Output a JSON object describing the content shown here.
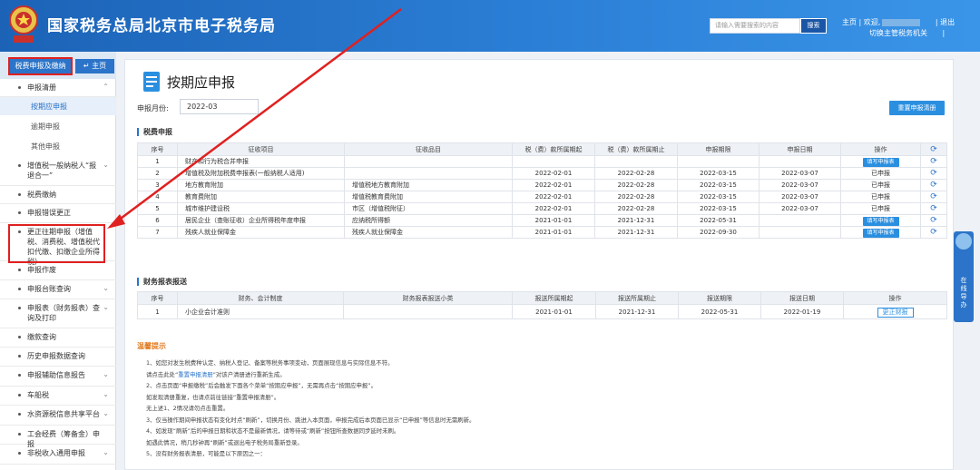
{
  "header": {
    "title": "国家税务总局北京市电子税务局",
    "search_placeholder": "请输入需要搜索的内容",
    "search_button": "搜索",
    "home_link": "主页",
    "sep1": "|",
    "welcome": "欢迎,",
    "sep2": "|",
    "logout": "退出",
    "switch_agency": "切换主管税务机关",
    "sep3": "|"
  },
  "sidebar": {
    "active_tab": "税费申报及缴纳",
    "home_tab": "主页",
    "home_icon": "arrow-left-icon",
    "items": [
      {
        "label": "申报清册"
      },
      {
        "label": "增值税一般纳税人“报退合一”"
      },
      {
        "label": "税费缴纳"
      },
      {
        "label": "申报错误更正"
      },
      {
        "label": "更正往期申报（增值税、消费税、增值税代扣代缴、扣缴企业所得税）"
      },
      {
        "label": "申报作废"
      },
      {
        "label": "申报台账查询"
      },
      {
        "label": "申报表（财务报表）查询及打印"
      },
      {
        "label": "缴款查询"
      },
      {
        "label": "历史申报数据查询"
      },
      {
        "label": "申报辅助信息报告"
      },
      {
        "label": "车船税"
      },
      {
        "label": "水资源税信息共享平台"
      },
      {
        "label": "工会经费（筹备金）申报"
      },
      {
        "label": "非税收入通用申报"
      }
    ],
    "subitems": [
      {
        "label": "按期应申报"
      },
      {
        "label": "逾期申报"
      },
      {
        "label": "其他申报"
      }
    ]
  },
  "main": {
    "title": "按期应申报",
    "month_label": "申报月份:",
    "month_value": "2022-03",
    "clear_button": "重置申报清册",
    "tax_section_title": "税费申报",
    "tax_headers": [
      "序号",
      "征收项目",
      "征收品目",
      "税（费）款所属期起",
      "税（费）款所属期止",
      "申报期限",
      "申报日期",
      "操作"
    ],
    "tax_rows": [
      {
        "no": "1",
        "item": "财产和行为税合并申报",
        "sub": "",
        "start": "",
        "end": "",
        "deadline": "",
        "date": "",
        "action": "填写申报表",
        "btn": true
      },
      {
        "no": "2",
        "item": "增值税及附加税费申报表(一般纳税人适用)",
        "sub": "",
        "start": "2022-02-01",
        "end": "2022-02-28",
        "deadline": "2022-03-15",
        "date": "2022-03-07",
        "action": "已申报",
        "btn": false
      },
      {
        "no": "3",
        "item": "地方教育附加",
        "sub": "增值税地方教育附加",
        "start": "2022-02-01",
        "end": "2022-02-28",
        "deadline": "2022-03-15",
        "date": "2022-03-07",
        "action": "已申报",
        "btn": false
      },
      {
        "no": "4",
        "item": "教育费附加",
        "sub": "增值税教育费附加",
        "start": "2022-02-01",
        "end": "2022-02-28",
        "deadline": "2022-03-15",
        "date": "2022-03-07",
        "action": "已申报",
        "btn": false
      },
      {
        "no": "5",
        "item": "城市维护建设税",
        "sub": "市区（增值税附征）",
        "start": "2022-02-01",
        "end": "2022-02-28",
        "deadline": "2022-03-15",
        "date": "2022-03-07",
        "action": "已申报",
        "btn": false
      },
      {
        "no": "6",
        "item": "居民企业（查账征收）企业所得税年度申报",
        "sub": "应纳税所得额",
        "start": "2021-01-01",
        "end": "2021-12-31",
        "deadline": "2022-05-31",
        "date": "",
        "action": "填写申报表",
        "btn": true
      },
      {
        "no": "7",
        "item": "残疾人就业保障金",
        "sub": "残疾人就业保障金",
        "start": "2021-01-01",
        "end": "2021-12-31",
        "deadline": "2022-09-30",
        "date": "",
        "action": "填写申报表",
        "btn": true
      }
    ],
    "fin_section_title": "财务报表报送",
    "fin_headers": [
      "序号",
      "财务、会计制度",
      "财务报表报送小类",
      "报送所属期起",
      "报送所属期止",
      "报送期限",
      "报送日期",
      "操作"
    ],
    "fin_rows": [
      {
        "no": "1",
        "system": "小企业会计准则",
        "sub": "",
        "start": "2021-01-01",
        "end": "2021-12-31",
        "deadline": "2022-05-31",
        "date": "2022-01-19",
        "action": "更正财报"
      }
    ],
    "tips_title": "温馨提示",
    "tips": [
      "1、如您对发生税费种认定、纳税人登记、备案等税务事项变动，页面展现信息与实际信息不符。",
      "请点击此处“重置申报清册”对该户清册进行重新生成。",
      "2、点击页面“申报缴税”后会触发下面各个菜单“按期应申报”，无需再点击“按期应申报”。",
      "如发现清册重复，也请点前往链接“重置申报清册”。",
      "无上述1、2情况请勿点击重置。",
      "3、仅当操作期间申报状态有变化时点“刷新”，切换月份、跳进入本页面，申报完成后本页面已显示“已申报”等信息时无需刷新。",
      "4、如发现“刷新”后的申报日期和状态不是最新情况，请等待或“刷新”按钮所查数据同步延时未刷。",
      "如遇此情况，稍几秒钟再“刷新”或退出电子税务局重新登录。",
      "5、没有财务报表清册，可能是以下原因之一："
    ],
    "tips_link": "重置申报清册"
  },
  "float_help": {
    "label": "在线导办"
  }
}
